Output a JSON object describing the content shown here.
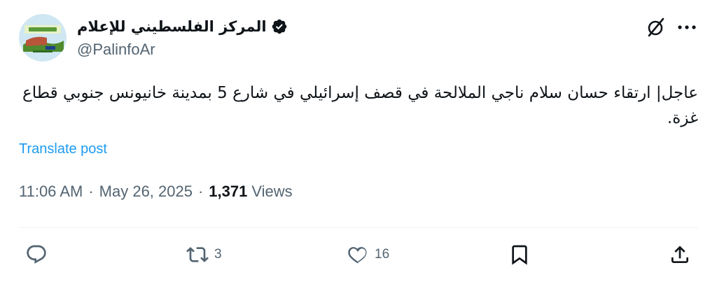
{
  "author": {
    "display_name": "المركز الفلسطيني للإعلام",
    "handle": "@PalinfoAr",
    "verified": true
  },
  "tweet": {
    "text": "عاجل| ارتقاء حسان سلام ناجي الملالحة في قصف إسرائيلي في شارع 5 بمدينة خانيونس جنوبي قطاع غزة.",
    "translate_label": "Translate post",
    "time": "11:06 AM",
    "date": "May 26, 2025",
    "views_count": "1,371",
    "views_label": "Views"
  },
  "actions": {
    "reply_count": "",
    "repost_count": "3",
    "like_count": "16"
  },
  "icons": {
    "grok": "grok-icon",
    "more": "more-icon",
    "reply": "reply-icon",
    "repost": "repost-icon",
    "like": "like-icon",
    "bookmark": "bookmark-icon",
    "share": "share-icon",
    "verified": "verified-badge-icon"
  },
  "colors": {
    "link": "#1d9bf0",
    "secondary_text": "#536471",
    "primary_text": "#0f1419",
    "divider": "#eff3f4"
  }
}
